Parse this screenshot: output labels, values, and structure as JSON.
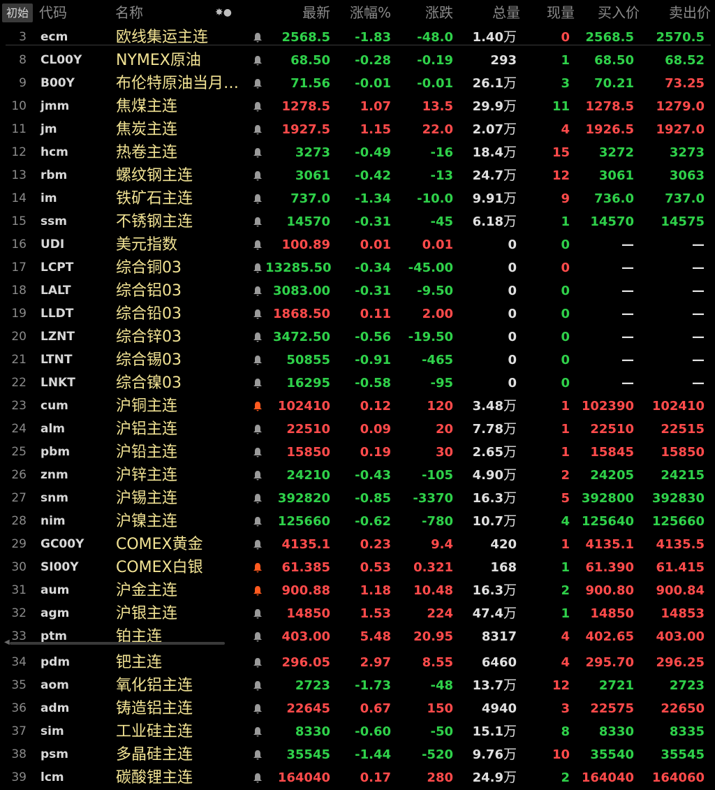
{
  "header": {
    "init_button": "初始",
    "col_code": "代码",
    "col_name": "名称",
    "col_last": "最新",
    "col_pct": "涨幅%",
    "col_chg": "涨跌",
    "col_vol": "总量",
    "col_now": "现量",
    "col_bid": "买入价",
    "col_ask": "卖出价",
    "icons": "✸●"
  },
  "colors": {
    "up": "#ff4b4b",
    "down": "#2fd14a",
    "name": "#f2e394",
    "bell_alert": "#ff5a1f",
    "bell_normal": "#9a9a9a"
  },
  "rows": [
    {
      "n": "3",
      "code": "ecm",
      "name": "欧线集运主连",
      "bell": "normal",
      "last": "2568.5",
      "pct": "-1.83",
      "chg": "-48.0",
      "vol": "1.40",
      "unit": "万",
      "now": "0",
      "bid": "2568.5",
      "ask": "2570.5",
      "d": "down",
      "dn": "up"
    },
    {
      "n": "8",
      "code": "CL00Y",
      "name": "NYMEX原油",
      "bell": "normal",
      "last": "68.50",
      "pct": "-0.28",
      "chg": "-0.19",
      "vol": "293",
      "unit": "",
      "now": "1",
      "bid": "68.50",
      "ask": "68.52",
      "d": "down",
      "dn": "down"
    },
    {
      "n": "9",
      "code": "B00Y",
      "name": "布伦特原油当月…",
      "bell": "normal",
      "last": "71.56",
      "pct": "-0.01",
      "chg": "-0.01",
      "vol": "26.1",
      "unit": "万",
      "now": "3",
      "bid": "70.21",
      "ask": "73.25",
      "d": "down",
      "dn": "down",
      "ask_d": "up"
    },
    {
      "n": "10",
      "code": "jmm",
      "name": "焦煤主连",
      "bell": "normal",
      "last": "1278.5",
      "pct": "1.07",
      "chg": "13.5",
      "vol": "29.9",
      "unit": "万",
      "now": "11",
      "bid": "1278.5",
      "ask": "1279.0",
      "d": "up",
      "dn": "down"
    },
    {
      "n": "11",
      "code": "jm",
      "name": "焦炭主连",
      "bell": "normal",
      "last": "1927.5",
      "pct": "1.15",
      "chg": "22.0",
      "vol": "2.07",
      "unit": "万",
      "now": "4",
      "bid": "1926.5",
      "ask": "1927.0",
      "d": "up",
      "dn": "up"
    },
    {
      "n": "12",
      "code": "hcm",
      "name": "热卷主连",
      "bell": "normal",
      "last": "3273",
      "pct": "-0.49",
      "chg": "-16",
      "vol": "18.4",
      "unit": "万",
      "now": "15",
      "bid": "3272",
      "ask": "3273",
      "d": "down",
      "dn": "up"
    },
    {
      "n": "13",
      "code": "rbm",
      "name": "螺纹钢主连",
      "bell": "normal",
      "last": "3061",
      "pct": "-0.42",
      "chg": "-13",
      "vol": "24.7",
      "unit": "万",
      "now": "12",
      "bid": "3061",
      "ask": "3063",
      "d": "down",
      "dn": "up"
    },
    {
      "n": "14",
      "code": "im",
      "name": "铁矿石主连",
      "bell": "normal",
      "last": "737.0",
      "pct": "-1.34",
      "chg": "-10.0",
      "vol": "9.91",
      "unit": "万",
      "now": "9",
      "bid": "736.0",
      "ask": "737.0",
      "d": "down",
      "dn": "up"
    },
    {
      "n": "15",
      "code": "ssm",
      "name": "不锈钢主连",
      "bell": "normal",
      "last": "14570",
      "pct": "-0.31",
      "chg": "-45",
      "vol": "6.18",
      "unit": "万",
      "now": "1",
      "bid": "14570",
      "ask": "14575",
      "d": "down",
      "dn": "down"
    },
    {
      "n": "16",
      "code": "UDI",
      "name": "美元指数",
      "bell": "normal",
      "last": "100.89",
      "pct": "0.01",
      "chg": "0.01",
      "vol": "0",
      "unit": "",
      "now": "0",
      "bid": "—",
      "ask": "—",
      "d": "up",
      "dn": "down"
    },
    {
      "n": "17",
      "code": "LCPT",
      "name": "综合铜03",
      "bell": "normal",
      "last": "13285.50",
      "pct": "-0.34",
      "chg": "-45.00",
      "vol": "0",
      "unit": "",
      "now": "0",
      "bid": "—",
      "ask": "—",
      "d": "down",
      "dn": "up"
    },
    {
      "n": "18",
      "code": "LALT",
      "name": "综合铝03",
      "bell": "normal",
      "last": "3083.00",
      "pct": "-0.31",
      "chg": "-9.50",
      "vol": "0",
      "unit": "",
      "now": "0",
      "bid": "—",
      "ask": "—",
      "d": "down",
      "dn": "down"
    },
    {
      "n": "19",
      "code": "LLDT",
      "name": "综合铅03",
      "bell": "normal",
      "last": "1868.50",
      "pct": "0.11",
      "chg": "2.00",
      "vol": "0",
      "unit": "",
      "now": "0",
      "bid": "—",
      "ask": "—",
      "d": "up",
      "dn": "down"
    },
    {
      "n": "20",
      "code": "LZNT",
      "name": "综合锌03",
      "bell": "normal",
      "last": "3472.50",
      "pct": "-0.56",
      "chg": "-19.50",
      "vol": "0",
      "unit": "",
      "now": "0",
      "bid": "—",
      "ask": "—",
      "d": "down",
      "dn": "down"
    },
    {
      "n": "21",
      "code": "LTNT",
      "name": "综合锡03",
      "bell": "normal",
      "last": "50855",
      "pct": "-0.91",
      "chg": "-465",
      "vol": "0",
      "unit": "",
      "now": "0",
      "bid": "—",
      "ask": "—",
      "d": "down",
      "dn": "down"
    },
    {
      "n": "22",
      "code": "LNKT",
      "name": "综合镍03",
      "bell": "normal",
      "last": "16295",
      "pct": "-0.58",
      "chg": "-95",
      "vol": "0",
      "unit": "",
      "now": "0",
      "bid": "—",
      "ask": "—",
      "d": "down",
      "dn": "down"
    },
    {
      "n": "23",
      "code": "cum",
      "name": "沪铜主连",
      "bell": "alert",
      "last": "102410",
      "pct": "0.12",
      "chg": "120",
      "vol": "3.48",
      "unit": "万",
      "now": "1",
      "bid": "102390",
      "ask": "102410",
      "d": "up",
      "dn": "up"
    },
    {
      "n": "24",
      "code": "alm",
      "name": "沪铝主连",
      "bell": "normal",
      "last": "22510",
      "pct": "0.09",
      "chg": "20",
      "vol": "7.78",
      "unit": "万",
      "now": "1",
      "bid": "22510",
      "ask": "22515",
      "d": "up",
      "dn": "up"
    },
    {
      "n": "25",
      "code": "pbm",
      "name": "沪铅主连",
      "bell": "normal",
      "last": "15850",
      "pct": "0.19",
      "chg": "30",
      "vol": "2.65",
      "unit": "万",
      "now": "1",
      "bid": "15845",
      "ask": "15850",
      "d": "up",
      "dn": "up"
    },
    {
      "n": "26",
      "code": "znm",
      "name": "沪锌主连",
      "bell": "normal",
      "last": "24210",
      "pct": "-0.43",
      "chg": "-105",
      "vol": "4.90",
      "unit": "万",
      "now": "2",
      "bid": "24205",
      "ask": "24215",
      "d": "down",
      "dn": "up"
    },
    {
      "n": "27",
      "code": "snm",
      "name": "沪锡主连",
      "bell": "normal",
      "last": "392820",
      "pct": "-0.85",
      "chg": "-3370",
      "vol": "16.3",
      "unit": "万",
      "now": "5",
      "bid": "392800",
      "ask": "392830",
      "d": "down",
      "dn": "up"
    },
    {
      "n": "28",
      "code": "nim",
      "name": "沪镍主连",
      "bell": "normal",
      "last": "125660",
      "pct": "-0.62",
      "chg": "-780",
      "vol": "10.7",
      "unit": "万",
      "now": "4",
      "bid": "125640",
      "ask": "125660",
      "d": "down",
      "dn": "down"
    },
    {
      "n": "29",
      "code": "GC00Y",
      "name": "COMEX黄金",
      "bell": "normal",
      "last": "4135.1",
      "pct": "0.23",
      "chg": "9.4",
      "vol": "420",
      "unit": "",
      "now": "1",
      "bid": "4135.1",
      "ask": "4135.5",
      "d": "up",
      "dn": "up"
    },
    {
      "n": "30",
      "code": "SI00Y",
      "name": "COMEX白银",
      "bell": "alert",
      "last": "61.385",
      "pct": "0.53",
      "chg": "0.321",
      "vol": "168",
      "unit": "",
      "now": "1",
      "bid": "61.390",
      "ask": "61.415",
      "d": "up",
      "dn": "down"
    },
    {
      "n": "31",
      "code": "aum",
      "name": "沪金主连",
      "bell": "alert",
      "last": "900.88",
      "pct": "1.18",
      "chg": "10.48",
      "vol": "16.3",
      "unit": "万",
      "now": "2",
      "bid": "900.80",
      "ask": "900.84",
      "d": "up",
      "dn": "down"
    },
    {
      "n": "32",
      "code": "agm",
      "name": "沪银主连",
      "bell": "normal",
      "last": "14850",
      "pct": "1.53",
      "chg": "224",
      "vol": "47.4",
      "unit": "万",
      "now": "1",
      "bid": "14850",
      "ask": "14853",
      "d": "up",
      "dn": "down"
    },
    {
      "n": "33",
      "code": "ptm",
      "name": "铂主连",
      "bell": "normal",
      "last": "403.00",
      "pct": "5.48",
      "chg": "20.95",
      "vol": "8317",
      "unit": "",
      "now": "4",
      "bid": "402.65",
      "ask": "403.00",
      "d": "up",
      "dn": "up"
    },
    {
      "n": "34",
      "code": "pdm",
      "name": "钯主连",
      "bell": "normal",
      "last": "296.05",
      "pct": "2.97",
      "chg": "8.55",
      "vol": "6460",
      "unit": "",
      "now": "4",
      "bid": "295.70",
      "ask": "296.25",
      "d": "up",
      "dn": "up"
    },
    {
      "n": "35",
      "code": "aom",
      "name": "氧化铝主连",
      "bell": "normal",
      "last": "2723",
      "pct": "-1.73",
      "chg": "-48",
      "vol": "13.7",
      "unit": "万",
      "now": "12",
      "bid": "2721",
      "ask": "2723",
      "d": "down",
      "dn": "up"
    },
    {
      "n": "36",
      "code": "adm",
      "name": "铸造铝主连",
      "bell": "normal",
      "last": "22645",
      "pct": "0.67",
      "chg": "150",
      "vol": "4940",
      "unit": "",
      "now": "3",
      "bid": "22575",
      "ask": "22650",
      "d": "up",
      "dn": "up"
    },
    {
      "n": "37",
      "code": "sim",
      "name": "工业硅主连",
      "bell": "normal",
      "last": "8330",
      "pct": "-0.60",
      "chg": "-50",
      "vol": "15.1",
      "unit": "万",
      "now": "8",
      "bid": "8330",
      "ask": "8335",
      "d": "down",
      "dn": "down"
    },
    {
      "n": "38",
      "code": "psm",
      "name": "多晶硅主连",
      "bell": "normal",
      "last": "35545",
      "pct": "-1.44",
      "chg": "-520",
      "vol": "9.76",
      "unit": "万",
      "now": "10",
      "bid": "35540",
      "ask": "35545",
      "d": "down",
      "dn": "up"
    },
    {
      "n": "39",
      "code": "lcm",
      "name": "碳酸锂主连",
      "bell": "normal",
      "last": "164040",
      "pct": "0.17",
      "chg": "280",
      "vol": "24.9",
      "unit": "万",
      "now": "2",
      "bid": "164040",
      "ask": "164060",
      "d": "up",
      "dn": "down"
    }
  ]
}
